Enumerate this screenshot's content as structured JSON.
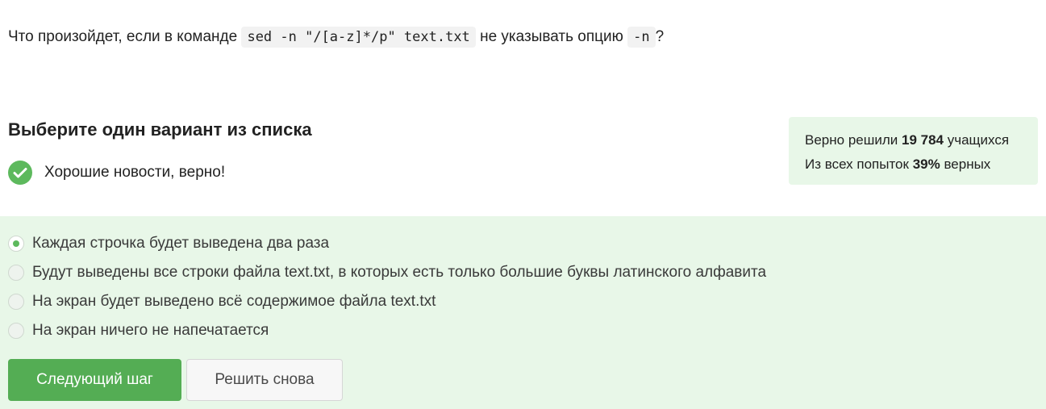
{
  "question": {
    "text_before": "Что произойдет, если в команде ",
    "code_command": "sed -n \"/[a-z]*/p\" text.txt",
    "text_middle": " не указывать опцию ",
    "code_option": "-n",
    "text_after": "?"
  },
  "prompt_title": "Выберите один вариант из списка",
  "feedback": {
    "message": "Хорошие новости, верно!",
    "icon": "check-circle-icon",
    "color": "#5db95d"
  },
  "stats": {
    "line1_prefix": "Верно решили ",
    "line1_count": "19 784",
    "line1_suffix": " учащихся",
    "line2_prefix": "Из всех попыток ",
    "line2_percent": "39%",
    "line2_suffix": " верных"
  },
  "options": [
    {
      "label": "Каждая строчка будет выведена два раза",
      "selected": true
    },
    {
      "label": "Будут выведены все строки файла text.txt, в которых есть только большие буквы латинского алфавита",
      "selected": false
    },
    {
      "label": "На экран будет выведено всё содержимое файла text.txt",
      "selected": false
    },
    {
      "label": "На экран ничего не напечатается",
      "selected": false
    }
  ],
  "buttons": {
    "next_label": "Следующий шаг",
    "retry_label": "Решить снова"
  },
  "colors": {
    "accent_green": "#54ad54",
    "panel_bg": "#e8f7e8"
  }
}
